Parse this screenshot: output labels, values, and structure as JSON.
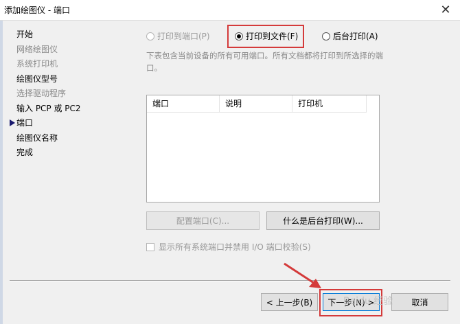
{
  "window": {
    "title": "添加绘图仪 - 端口",
    "close_glyph": "✕"
  },
  "sidebar": {
    "items": [
      {
        "label": "开始",
        "disabled": false,
        "current": false
      },
      {
        "label": "网络绘图仪",
        "disabled": true,
        "current": false
      },
      {
        "label": "系统打印机",
        "disabled": true,
        "current": false
      },
      {
        "label": "绘图仪型号",
        "disabled": false,
        "current": false
      },
      {
        "label": "选择驱动程序",
        "disabled": true,
        "current": false
      },
      {
        "label": "输入 PCP 或 PC2",
        "disabled": false,
        "current": false
      },
      {
        "label": "端口",
        "disabled": false,
        "current": true
      },
      {
        "label": "绘图仪名称",
        "disabled": false,
        "current": false
      },
      {
        "label": "完成",
        "disabled": false,
        "current": false
      }
    ]
  },
  "options": {
    "port": {
      "label": "打印到端口(P)",
      "selected": false,
      "disabled": true
    },
    "file": {
      "label": "打印到文件(F)",
      "selected": true,
      "disabled": false
    },
    "background": {
      "label": "后台打印(A)",
      "selected": false,
      "disabled": false
    }
  },
  "description": "下表包含当前设备的所有可用端口。所有文档都将打印到所选择的端口。",
  "table": {
    "columns": [
      "端口",
      "说明",
      "打印机"
    ],
    "rows": []
  },
  "buttons": {
    "configure": "配置端口(C)...",
    "what_is_background": "什么是后台打印(W)...",
    "back": "< 上一步(B)",
    "next": "下一步(N) >",
    "cancel": "取消"
  },
  "checkbox": {
    "label": "显示所有系统端口并禁用 I/O 端口校验(S)",
    "checked": false,
    "disabled": true
  },
  "watermark": "Baidu 经验",
  "colors": {
    "highlight": "#d43a3a",
    "marker": "#1a1a6e"
  }
}
